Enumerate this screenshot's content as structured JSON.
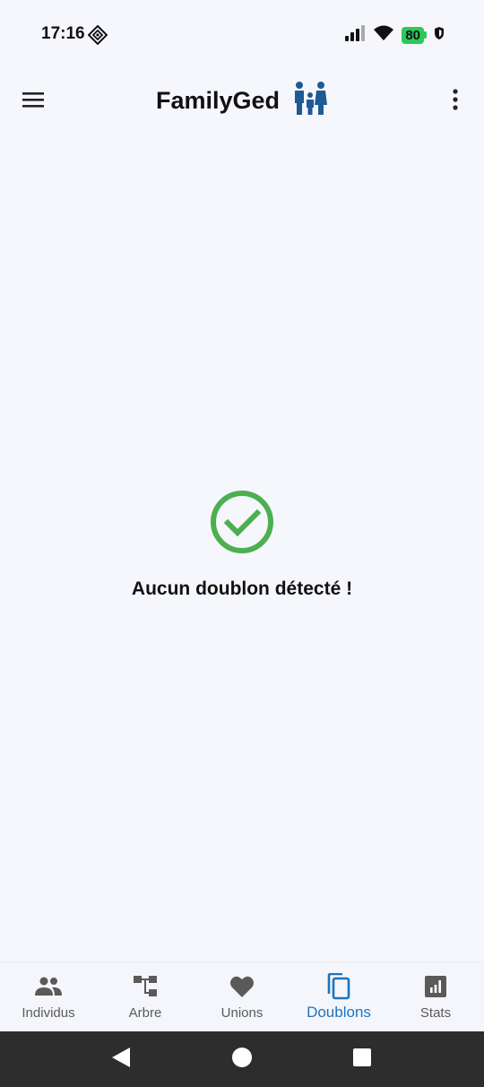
{
  "status_bar": {
    "time": "17:16",
    "battery_level": "80",
    "battery_color": "#2ec85a"
  },
  "app_bar": {
    "title": "FamilyGed",
    "logo_color": "#1e5a96",
    "menu_icon": "hamburger-menu-icon",
    "more_icon": "more-vert-icon"
  },
  "main": {
    "empty_message": "Aucun doublon détecté !",
    "status_icon": "check-circle-icon",
    "status_color": "#4caf50"
  },
  "bottom_nav": {
    "active_color": "#1e73be",
    "inactive_color": "#5a5a5a",
    "items": [
      {
        "label": "Individus",
        "icon": "people-icon"
      },
      {
        "label": "Arbre",
        "icon": "tree-icon"
      },
      {
        "label": "Unions",
        "icon": "heart-icon"
      },
      {
        "label": "Doublons",
        "icon": "copy-icon",
        "active": true
      },
      {
        "label": "Stats",
        "icon": "stats-icon"
      }
    ]
  },
  "system_nav": {
    "back_icon": "back-triangle-icon",
    "home_icon": "home-circle-icon",
    "recents_icon": "recents-square-icon"
  }
}
